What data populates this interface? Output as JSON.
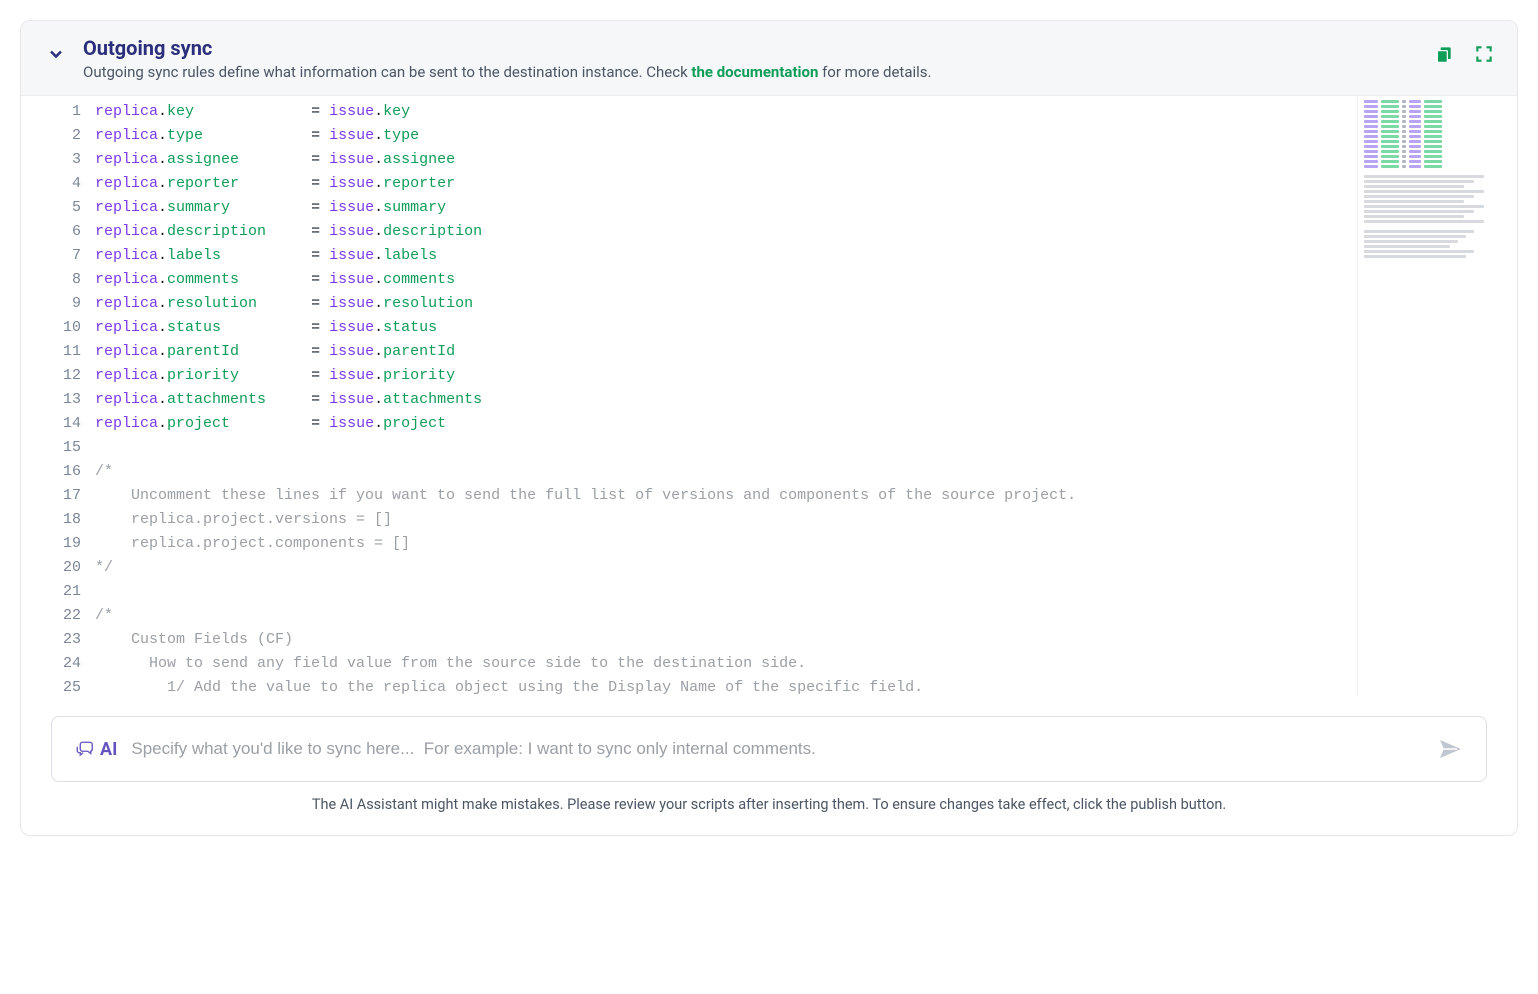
{
  "header": {
    "title": "Outgoing sync",
    "subtitle_pre": "Outgoing sync rules define what information can be sent to the destination instance. Check ",
    "doc_link_text": "the documentation",
    "subtitle_post": " for more details."
  },
  "code": {
    "assignments": [
      {
        "left_obj": "replica",
        "left_prop": "key",
        "right_obj": "issue",
        "right_prop": "key"
      },
      {
        "left_obj": "replica",
        "left_prop": "type",
        "right_obj": "issue",
        "right_prop": "type"
      },
      {
        "left_obj": "replica",
        "left_prop": "assignee",
        "right_obj": "issue",
        "right_prop": "assignee"
      },
      {
        "left_obj": "replica",
        "left_prop": "reporter",
        "right_obj": "issue",
        "right_prop": "reporter"
      },
      {
        "left_obj": "replica",
        "left_prop": "summary",
        "right_obj": "issue",
        "right_prop": "summary"
      },
      {
        "left_obj": "replica",
        "left_prop": "description",
        "right_obj": "issue",
        "right_prop": "description"
      },
      {
        "left_obj": "replica",
        "left_prop": "labels",
        "right_obj": "issue",
        "right_prop": "labels"
      },
      {
        "left_obj": "replica",
        "left_prop": "comments",
        "right_obj": "issue",
        "right_prop": "comments"
      },
      {
        "left_obj": "replica",
        "left_prop": "resolution",
        "right_obj": "issue",
        "right_prop": "resolution"
      },
      {
        "left_obj": "replica",
        "left_prop": "status",
        "right_obj": "issue",
        "right_prop": "status"
      },
      {
        "left_obj": "replica",
        "left_prop": "parentId",
        "right_obj": "issue",
        "right_prop": "parentId"
      },
      {
        "left_obj": "replica",
        "left_prop": "priority",
        "right_obj": "issue",
        "right_prop": "priority"
      },
      {
        "left_obj": "replica",
        "left_prop": "attachments",
        "right_obj": "issue",
        "right_prop": "attachments"
      },
      {
        "left_obj": "replica",
        "left_prop": "project",
        "right_obj": "issue",
        "right_prop": "project"
      }
    ],
    "comment_lines": [
      "",
      "/*",
      "    Uncomment these lines if you want to send the full list of versions and components of the source project.",
      "    replica.project.versions = []",
      "    replica.project.components = []",
      "*/",
      "",
      "/*",
      "    Custom Fields (CF)",
      "      How to send any field value from the source side to the destination side.",
      "        1/ Add the value to the replica object using the Display Name of the specific field."
    ],
    "left_col_width_ch": 24
  },
  "ai": {
    "label": "AI",
    "placeholder": "Specify what you'd like to sync here...  For example: I want to sync only internal comments.",
    "disclaimer": "The AI Assistant might make mistakes. Please review your scripts after inserting them. To ensure changes take effect, click the publish button."
  },
  "icons": {
    "copy": "copy-icon",
    "expand": "expand-icon",
    "chevron": "chevron-down-icon",
    "chat": "chat-icon",
    "send": "send-icon"
  }
}
